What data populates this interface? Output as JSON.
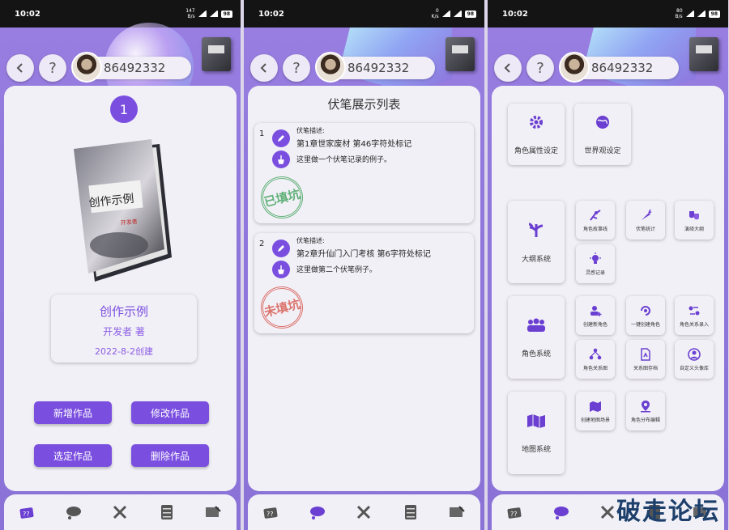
{
  "status_bars": [
    {
      "time": "10:02",
      "speed_value": "147",
      "speed_unit": "B/s",
      "battery": "98"
    },
    {
      "time": "10:02",
      "speed_value": "0",
      "speed_unit": "K/s",
      "battery": "98"
    },
    {
      "time": "10:02",
      "speed_value": "80",
      "speed_unit": "B/s",
      "battery": "98"
    }
  ],
  "user": {
    "id": "86492332"
  },
  "topbar": {
    "back_icon": "chevron-left-icon",
    "help_label": "?"
  },
  "panel1": {
    "index": "1",
    "book_cover_title": "创作示例",
    "book_cover_author": "开发者",
    "title": "创作示例",
    "author": "开发者 著",
    "date": "2022-8-2创建",
    "buttons": {
      "add": "新增作品",
      "edit": "修改作品",
      "select": "选定作品",
      "delete": "删除作品"
    }
  },
  "panel2": {
    "title": "伏笔展示列表",
    "items": [
      {
        "index": "1",
        "label": "伏笔描述:",
        "desc": "第1章世家废材  第46字符处标记",
        "note": "这里做一个伏笔记录的例子。",
        "stamp": "已填坑",
        "stamp_color": "#3ea25a"
      },
      {
        "index": "2",
        "label": "伏笔描述:",
        "desc": "第2章升仙门入门考核  第6字符处标记",
        "note": "这里做第二个伏笔例子。",
        "stamp": "未填坑",
        "stamp_color": "#d6544a"
      }
    ]
  },
  "panel3": {
    "tiles": {
      "attr": "角色属性设定",
      "world": "世界观设定",
      "outline": "大纲系统",
      "story": "角色故事线",
      "foreshadow": "伏笔统计",
      "deduce": "演绎大纲",
      "inspire": "灵感记录",
      "roles": "角色系统",
      "new_role": "创建新角色",
      "one_click": "一键创建角色",
      "relation_in": "角色关系录入",
      "relation_map": "角色关系图",
      "relation_archive": "关系图存档",
      "avatar_lib": "自定义头像库",
      "map": "地图系统",
      "create_map": "创建地图场景",
      "role_dist": "角色分布编辑"
    }
  },
  "tabbar": [
    "cards-icon",
    "thought-icon",
    "tools-icon",
    "cabinet-icon",
    "scroll-icon"
  ],
  "watermark": "破走论坛",
  "colors": {
    "accent": "#7a4fe0",
    "card": "#f2f0f7",
    "bg": "#8f77db"
  }
}
